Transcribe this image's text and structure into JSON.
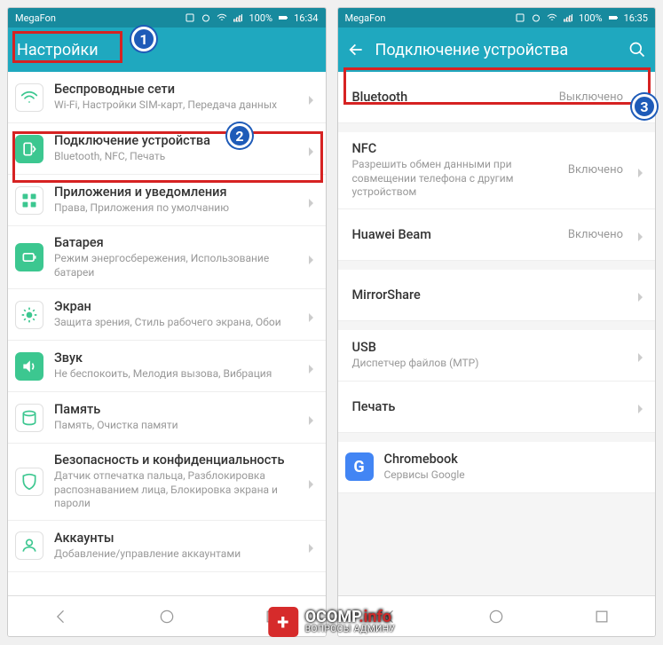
{
  "left": {
    "status": {
      "carrier": "MegaFon",
      "battery": "100%",
      "time": "16:34"
    },
    "header": {
      "title": "Настройки"
    },
    "items": [
      {
        "title": "Беспроводные сети",
        "sub": "Wi-Fi, Настройки SIM-карт, Передача данных",
        "icon": "wifi"
      },
      {
        "title": "Подключение устройства",
        "sub": "Bluetooth, NFC, Печать",
        "icon": "device-connect"
      },
      {
        "title": "Приложения и уведомления",
        "sub": "Права, Приложения по умолчанию",
        "icon": "apps"
      },
      {
        "title": "Батарея",
        "sub": "Режим энергосбережения, Использование батареи",
        "icon": "battery"
      },
      {
        "title": "Экран",
        "sub": "Защита зрения, Стиль рабочего экрана, Обои",
        "icon": "display"
      },
      {
        "title": "Звук",
        "sub": "Не беспокоить, Мелодия вызова, Вибрация",
        "icon": "sound"
      },
      {
        "title": "Память",
        "sub": "Память, Очистка памяти",
        "icon": "storage"
      },
      {
        "title": "Безопасность и конфиденциальность",
        "sub": "Датчик отпечатка пальца, Разблокировка распознаванием лица, Блокировка экрана и пароли",
        "icon": "security"
      },
      {
        "title": "Аккаунты",
        "sub": "Добавление/управление аккаунтами",
        "icon": "accounts"
      }
    ]
  },
  "right": {
    "status": {
      "carrier": "MegaFon",
      "battery": "100%",
      "time": "16:35"
    },
    "header": {
      "title": "Подключение устройства"
    },
    "items": [
      {
        "title": "Bluetooth",
        "value": "Выключено"
      },
      {
        "title": "NFC",
        "sub": "Разрешить обмен данными при совмещении телефона с другим устройством",
        "value": "Включено"
      },
      {
        "title": "Huawei Beam",
        "value": "Включено"
      },
      {
        "title": "MirrorShare"
      },
      {
        "title": "USB",
        "sub": "Диспетчер файлов (MTP)"
      },
      {
        "title": "Печать"
      },
      {
        "title": "Chromebook",
        "sub": "Сервисы Google",
        "icon": "google"
      }
    ]
  },
  "badges": {
    "b1": "1",
    "b2": "2",
    "b3": "3"
  },
  "watermark": {
    "line1a": "OCOMP",
    "line1b": ".info",
    "line2": "ВОПРОСЫ АДМИНУ"
  }
}
